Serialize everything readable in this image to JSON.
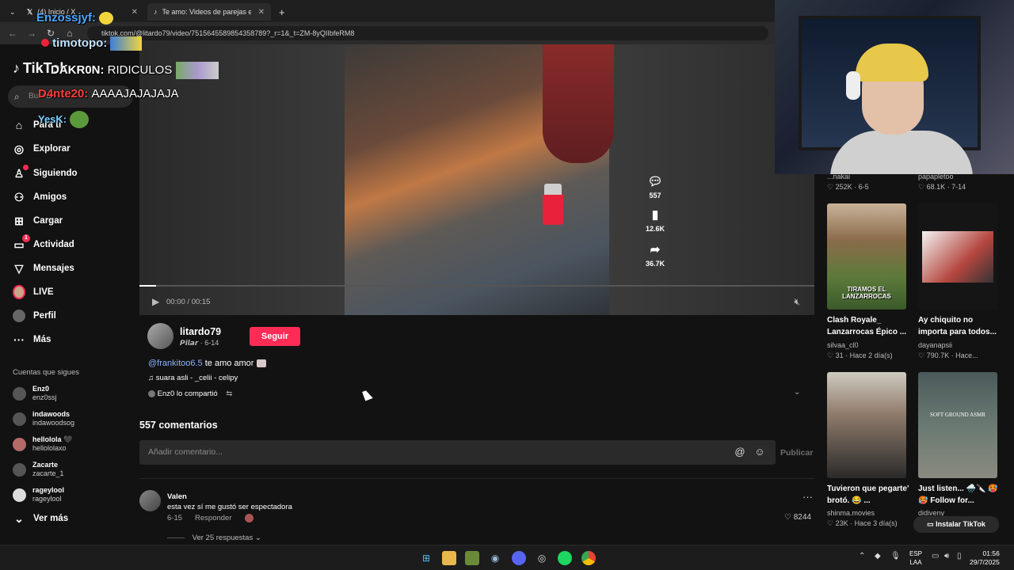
{
  "browser": {
    "tabs": [
      {
        "label": "(4) Inicio / X",
        "icon": "x-logo-icon"
      },
      {
        "label": "Te amo: Videos de parejas ena",
        "icon": "tiktok-icon"
      }
    ],
    "url": "tiktok.com/@litardo79/video/7515645589854358789?_r=1&_t=ZM-8yQIIbfeRM8"
  },
  "sidebar": {
    "logo": "TikTok",
    "search_placeholder": "Buscar",
    "nav": [
      {
        "label": "Para ti",
        "icon": "home-icon"
      },
      {
        "label": "Explorar",
        "icon": "compass-icon"
      },
      {
        "label": "Siguiendo",
        "icon": "following-icon"
      },
      {
        "label": "Amigos",
        "icon": "friends-icon"
      },
      {
        "label": "Cargar",
        "icon": "upload-icon"
      },
      {
        "label": "Actividad",
        "icon": "activity-icon",
        "badge": "1"
      },
      {
        "label": "Mensajes",
        "icon": "messages-icon"
      },
      {
        "label": "LIVE",
        "icon": "live-icon"
      },
      {
        "label": "Perfil",
        "icon": "profile-icon"
      },
      {
        "label": "Más",
        "icon": "more-icon"
      }
    ],
    "following_title": "Cuentas que sigues",
    "following": [
      {
        "name": "Enz0",
        "handle": "enz0ssj"
      },
      {
        "name": "indawoods",
        "handle": "indawoodsog"
      },
      {
        "name": "hellolola 🖤",
        "handle": "hellololaxo"
      },
      {
        "name": "Zacarte",
        "handle": "zacarte_1"
      },
      {
        "name": "rageylool",
        "handle": "rageylool"
      }
    ],
    "see_more": "Ver más"
  },
  "video": {
    "time": "00:00 / 00:15",
    "progress": 0.025,
    "actions": [
      {
        "icon": "comment-icon",
        "count": "557"
      },
      {
        "icon": "bookmark-icon",
        "count": "12.6K"
      },
      {
        "icon": "share-icon",
        "count": "36.7K"
      }
    ]
  },
  "post": {
    "author": "litardo79",
    "author_sub": "𝙋𝙞𝙡𝙖𝙧 · 6-14",
    "follow_label": "Seguir",
    "mention": "@frankitoo6.5",
    "caption": "te amo amor",
    "music": "♫ suara asli - _celii - celipy",
    "shared": "Enz0 lo compartió"
  },
  "comments": {
    "title": "557 comentarios",
    "input_placeholder": "Añadir comentario...",
    "publish_label": "Publicar",
    "items": [
      {
        "name": "Valen",
        "text": "esta vez sí me gustó ser espectadora",
        "date": "6-15",
        "reply_label": "Responder",
        "likes": "8244",
        "replies": "Ver 25 respuestas"
      }
    ]
  },
  "related": [
    {
      "title": "",
      "author": "...nakai",
      "meta": "♡ 252K · 6-5"
    },
    {
      "title": "",
      "author": "papapletoo",
      "meta": "♡ 68.1K · 7-14"
    },
    {
      "title": "Clash Royale_ Lanzarrocas Épico ...",
      "author": "silvaa_cl0",
      "meta": "♡ 31 · Hace 2 día(s)",
      "thumb_text": "TIRAMOS EL LANZARROCAS"
    },
    {
      "title": "Ay chiquito no importa para todos...",
      "author": "dayanapsii",
      "meta": "♡ 790.7K · Hace..."
    },
    {
      "title": "Tuvieron que pegarte' brotó. 😂 ...",
      "author": "shinma.movies",
      "meta": "♡ 23K · Hace 3 día(s)"
    },
    {
      "title": "Just listen... 🌧️🔪 🥵🥵 Follow for...",
      "author": "didiveny",
      "meta": "",
      "thumb_text": "SOFT GROUND ASMR"
    }
  ],
  "install_label": "Instalar TikTok",
  "chat": [
    {
      "user": "Enzossjyf:",
      "message": "",
      "color": "#4aa8ff"
    },
    {
      "user": "timotopo:",
      "message": "",
      "color": "#bfe3ff"
    },
    {
      "user": "DAKR0N:",
      "message": "RIDICULOS",
      "color": "#fff"
    },
    {
      "user": "D4nte20:",
      "message": "AAAAJAJAJAJA",
      "color": "#ff3b3b"
    },
    {
      "user": "YesK:",
      "message": "",
      "color": "#7fd0ff"
    }
  ],
  "taskbar": {
    "lang_line1": "ESP",
    "lang_line2": "LAA",
    "time": "01:56",
    "date": "29/7/2025"
  },
  "colors": {
    "accent": "#fe2c55",
    "mention": "#8ab4f8"
  }
}
